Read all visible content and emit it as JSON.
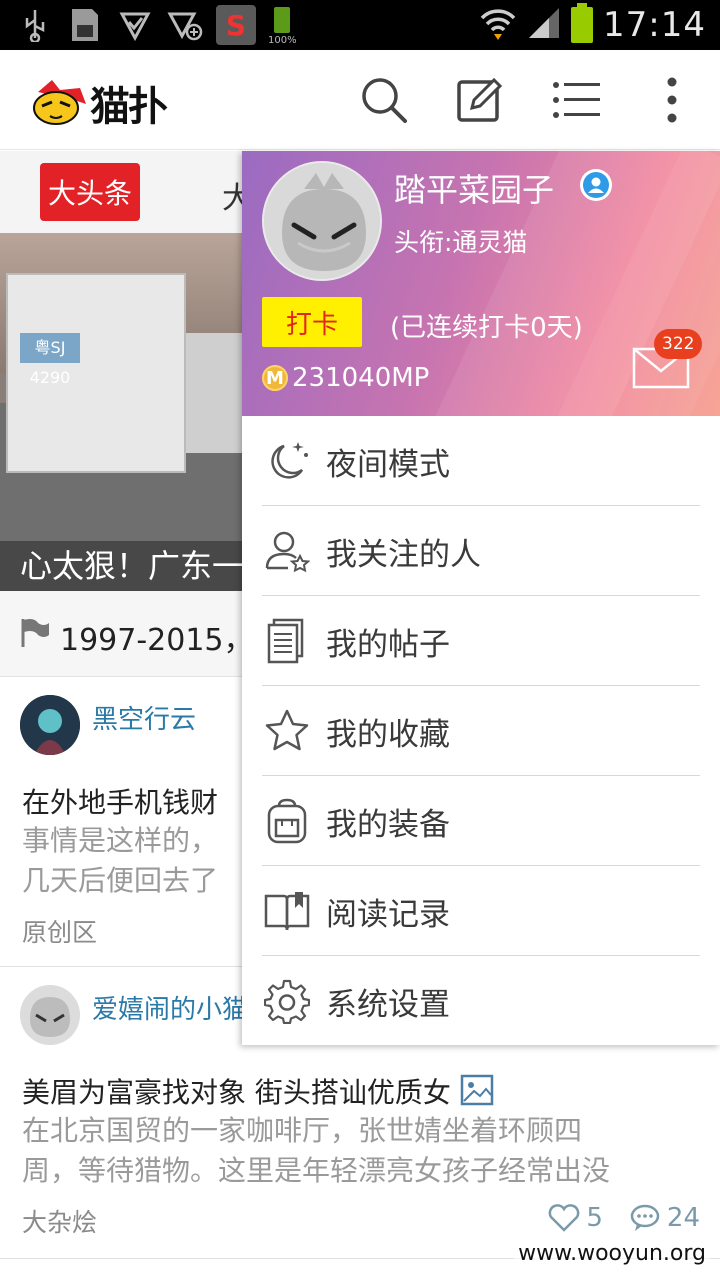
{
  "status_bar": {
    "battery_small_label": "100%",
    "time": "17:14",
    "colors": {
      "background": "#000000",
      "battery": "#99cc00"
    }
  },
  "app_header": {
    "logo_text": "猫扑",
    "icons": [
      "search-icon",
      "edit-icon",
      "list-icon",
      "more-icon"
    ]
  },
  "feed": {
    "tabs": [
      {
        "label": "大头条",
        "active": true
      },
      {
        "label": "大"
      }
    ],
    "banner": {
      "caption": "心太狠！广东一",
      "plate": "粤SJ 4290"
    },
    "notice": {
      "text": "1997-2015，"
    },
    "posts": [
      {
        "author": "黑空行云",
        "title": "在外地手机钱财",
        "excerpt": [
          "事情是这样的，",
          "几天后便回去了"
        ],
        "section": "原创区"
      },
      {
        "author": "爱嬉闹的小猫",
        "title": "美眉为富豪找对象 街头搭讪优质女",
        "excerpt": [
          "在北京国贸的一家咖啡厅，张世婧坐着环顾四",
          "周，等待猎物。这里是年轻漂亮女孩子经常出没"
        ],
        "section": "大杂烩",
        "likes": "5",
        "comments": "24"
      }
    ]
  },
  "drawer": {
    "user": {
      "name": "踏平菜园子",
      "rank": "头衔:通灵猫",
      "checkin_label": "打卡",
      "streak": "(已连续打卡0天)",
      "mp": "231040MP",
      "mail_count": "322"
    },
    "menu": [
      {
        "label": "夜间模式",
        "icon": "moon-icon"
      },
      {
        "label": "我关注的人",
        "icon": "follow-icon"
      },
      {
        "label": "我的帖子",
        "icon": "posts-icon"
      },
      {
        "label": "我的收藏",
        "icon": "star-icon"
      },
      {
        "label": "我的装备",
        "icon": "backpack-icon"
      },
      {
        "label": "阅读记录",
        "icon": "book-icon"
      },
      {
        "label": "系统设置",
        "icon": "gear-icon"
      }
    ],
    "colors": {
      "header_start": "#9a6bc2",
      "header_end": "#f6a596",
      "checkin_bg": "#ffef00",
      "checkin_text": "#e2261b",
      "badge": "#e8401f"
    }
  },
  "watermark": "www.wooyun.org"
}
